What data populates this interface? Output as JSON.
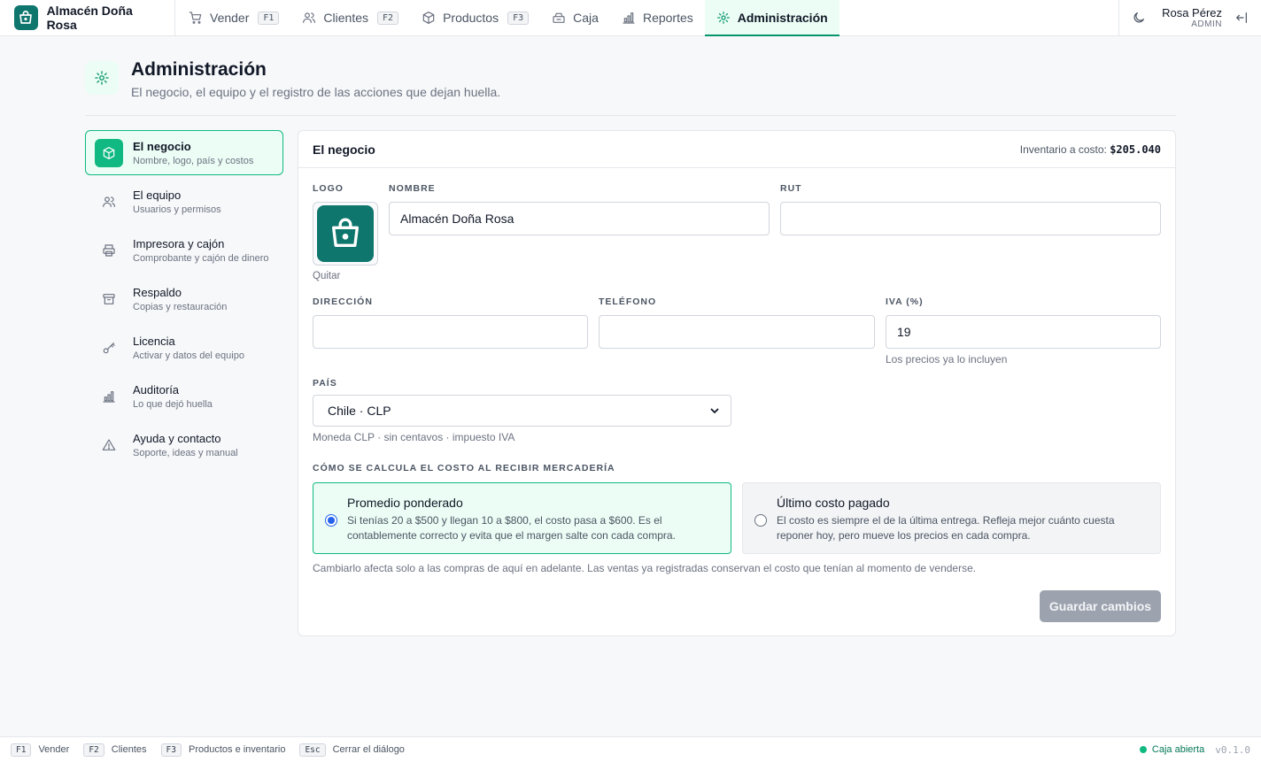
{
  "app": {
    "name": "Almacén Doña Rosa"
  },
  "nav": [
    {
      "label": "Vender",
      "key": "F1",
      "icon": "cart-icon"
    },
    {
      "label": "Clientes",
      "key": "F2",
      "icon": "users-icon"
    },
    {
      "label": "Productos",
      "key": "F3",
      "icon": "box-icon"
    },
    {
      "label": "Caja",
      "key": "",
      "icon": "register-icon"
    },
    {
      "label": "Reportes",
      "key": "",
      "icon": "bar-chart-icon"
    },
    {
      "label": "Administración",
      "key": "",
      "icon": "gear-icon",
      "active": true
    }
  ],
  "user": {
    "name": "Rosa Pérez",
    "role": "ADMIN"
  },
  "header": {
    "title": "Administración",
    "subtitle": "El negocio, el equipo y el registro de las acciones que dejan huella."
  },
  "side_menu": [
    {
      "title": "El negocio",
      "desc": "Nombre, logo, país y costos",
      "icon": "box-icon",
      "active": true
    },
    {
      "title": "El equipo",
      "desc": "Usuarios y permisos",
      "icon": "users-icon"
    },
    {
      "title": "Impresora y cajón",
      "desc": "Comprobante y cajón de dinero",
      "icon": "printer-icon"
    },
    {
      "title": "Respaldo",
      "desc": "Copias y restauración",
      "icon": "archive-icon"
    },
    {
      "title": "Licencia",
      "desc": "Activar y datos del equipo",
      "icon": "key-icon"
    },
    {
      "title": "Auditoría",
      "desc": "Lo que dejó huella",
      "icon": "bar-chart-icon"
    },
    {
      "title": "Ayuda y contacto",
      "desc": "Soporte, ideas y manual",
      "icon": "warning-icon"
    }
  ],
  "card": {
    "title": "El negocio",
    "inventory_label": "Inventario a costo:",
    "inventory_value": "$205.040",
    "logo_label": "LOGO",
    "logo_remove": "Quitar",
    "name_label": "NOMBRE",
    "name_value": "Almacén Doña Rosa",
    "rut_label": "RUT",
    "rut_value": "",
    "address_label": "DIRECCIÓN",
    "address_value": "",
    "phone_label": "TELÉFONO",
    "phone_value": "",
    "iva_label": "IVA (%)",
    "iva_value": "19",
    "iva_hint": "Los precios ya lo incluyen",
    "country_label": "PAÍS",
    "country_value": "Chile · CLP",
    "country_hint": "Moneda CLP · sin centavos · impuesto IVA",
    "cost_label": "CÓMO SE CALCULA EL COSTO AL RECIBIR MERCADERÍA",
    "options": [
      {
        "title": "Promedio ponderado",
        "desc": "Si tenías 20 a $500 y llegan 10 a $800, el costo pasa a $600. Es el contablemente correcto y evita que el margen salte con cada compra.",
        "selected": true
      },
      {
        "title": "Último costo pagado",
        "desc": "El costo es siempre el de la última entrega. Refleja mejor cuánto cuesta reponer hoy, pero mueve los precios en cada compra.",
        "selected": false
      }
    ],
    "cost_note": "Cambiarlo afecta solo a las compras de aquí en adelante. Las ventas ya registradas conservan el costo que tenían al momento de venderse.",
    "save_label": "Guardar cambios"
  },
  "bottom": {
    "shortcuts": [
      {
        "key": "F1",
        "label": "Vender"
      },
      {
        "key": "F2",
        "label": "Clientes"
      },
      {
        "key": "F3",
        "label": "Productos e inventario"
      },
      {
        "key": "Esc",
        "label": "Cerrar el diálogo"
      }
    ],
    "status": "Caja abierta",
    "version": "v0.1.0"
  },
  "colors": {
    "accent": "#10b981",
    "brand": "#0f766e",
    "active_bg": "#ecfdf5"
  }
}
